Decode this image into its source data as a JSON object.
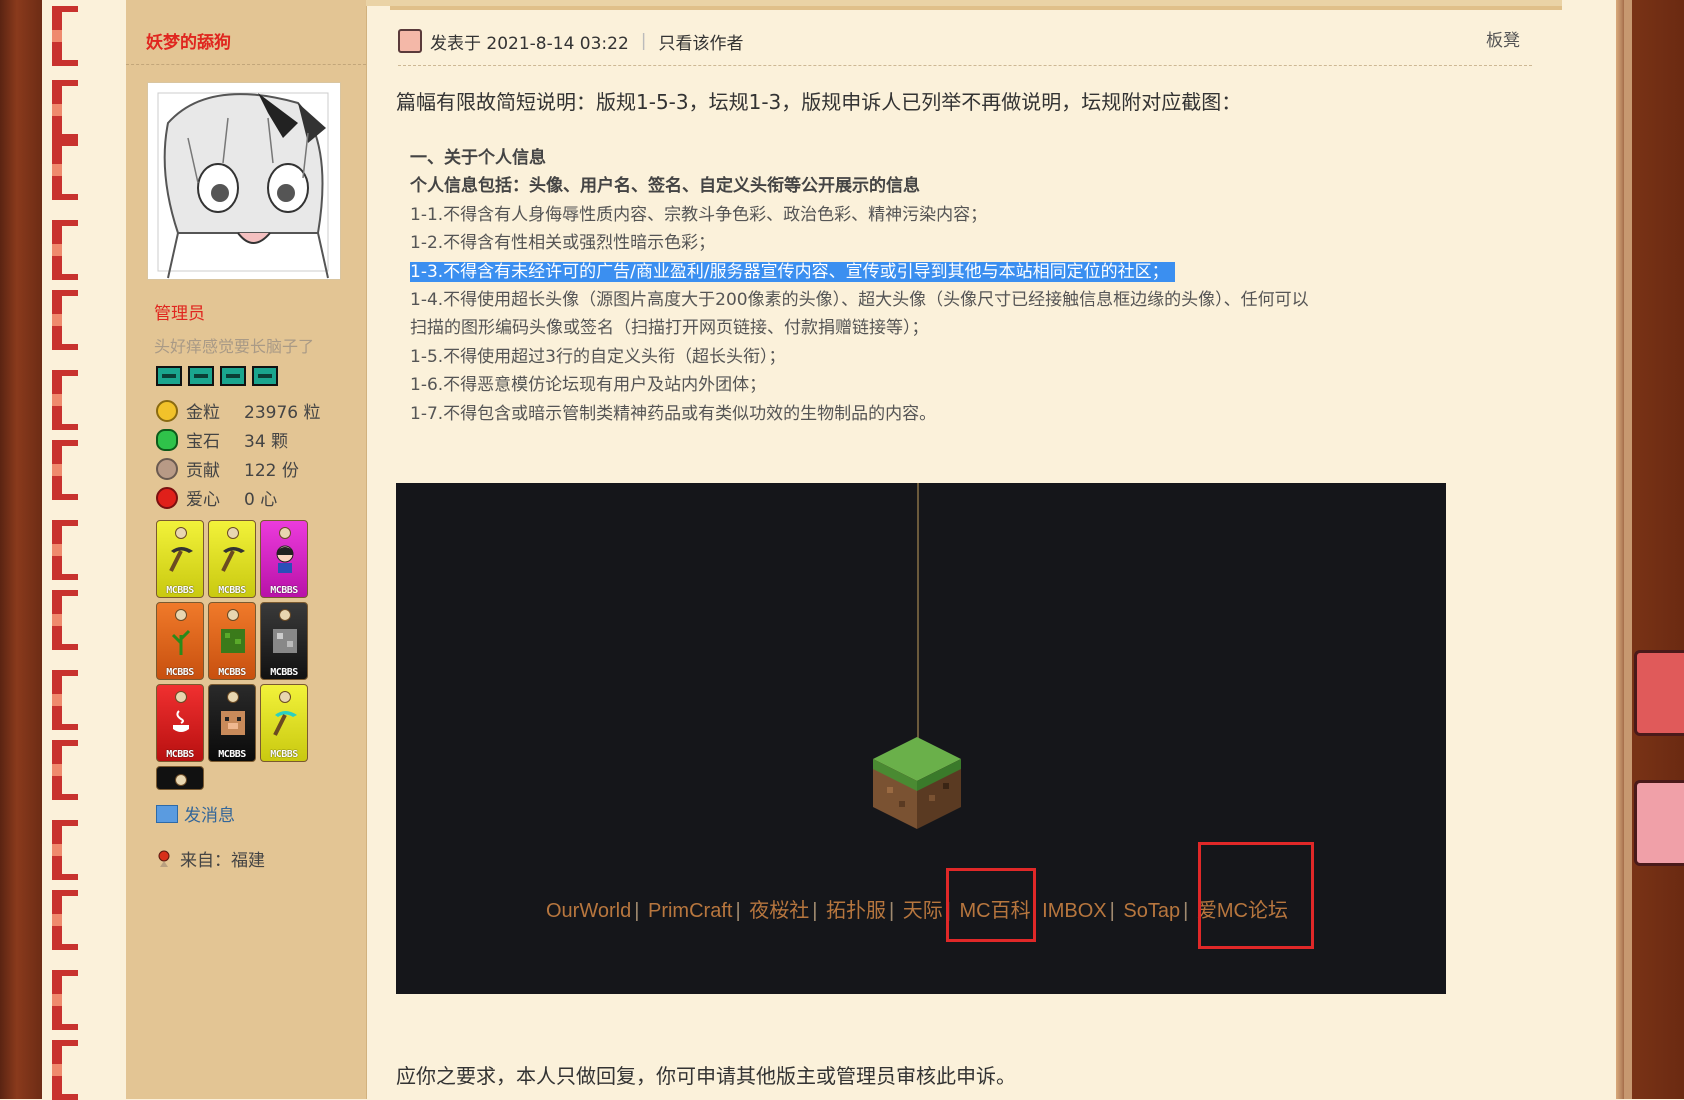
{
  "author": {
    "name": "妖梦的舔狗",
    "role": "管理员",
    "custom_title": "头好痒感觉要长脑子了",
    "stats": [
      {
        "icon": "gold-nugget-icon",
        "label": "金粒",
        "value": "23976 粒"
      },
      {
        "icon": "emerald-icon",
        "label": "宝石",
        "value": "34 颗"
      },
      {
        "icon": "contribution-icon",
        "label": "贡献",
        "value": "122 份"
      },
      {
        "icon": "apple-heart-icon",
        "label": "爱心",
        "value": "0 心"
      }
    ],
    "medal_tag": "MCBBS",
    "send_message": "发消息",
    "from": "来自：福建"
  },
  "post": {
    "posted_at": "发表于 2021-8-14 03:22",
    "only_author": "只看该作者",
    "floor": "板凳",
    "intro": "篇幅有限故简短说明：版规1-5-3，坛规1-3，版规申诉人已列举不再做说明，坛规附对应截图：",
    "rules": {
      "heading": "一、关于个人信息",
      "subheading": "个人信息包括：头像、用户名、签名、自定义头衔等公开展示的信息",
      "r1": "1-1.不得含有人身侮辱性质内容、宗教斗争色彩、政治色彩、精神污染内容；",
      "r2": "1-2.不得含有性相关或强烈性暗示色彩；",
      "r3": "1-3.不得含有未经许可的广告/商业盈利/服务器宣传内容、宣传或引导到其他与本站相同定位的社区；",
      "r4a": "1-4.不得使用超长头像（源图片高度大于200像素的头像）、超大头像（头像尺寸已经接触信息框边缘的头像）、任何可以",
      "r4b": "扫描的图形编码头像或签名（扫描打开网页链接、付款捐赠链接等）；",
      "r5": "1-5.不得使用超过3行的自定义头衔（超长头衔）；",
      "r6": "1-6.不得恶意模仿论坛现有用户及站内外团体；",
      "r7": "1-7.不得包含或暗示管制类精神药品或有类似功效的生物制品的内容。"
    },
    "screenshot_links": [
      "OurWorld",
      "PrimCraft",
      "夜桜社",
      "拓扑服",
      "天际",
      "MC百科",
      "IMBOX",
      "SoTap",
      "爱MC论坛"
    ],
    "footer": "应你之要求，本人只做回复，你可申请其他版主或管理员审核此申诉。"
  },
  "colors": {
    "accent_red": "#e0261f",
    "highlight_blue": "#3b8ff0",
    "link_orange": "#b7763e",
    "box_red": "#e02828"
  }
}
